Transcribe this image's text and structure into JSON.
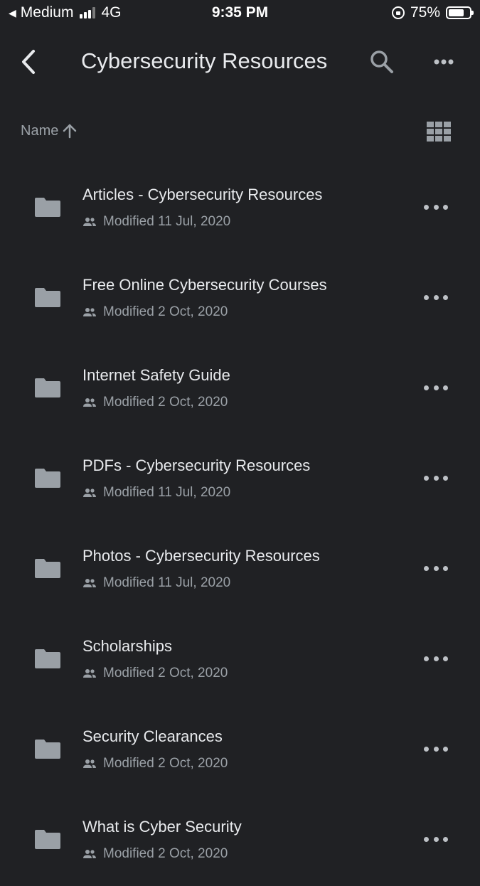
{
  "status_bar": {
    "carrier": "Medium",
    "network": "4G",
    "time": "9:35 PM",
    "battery": "75%",
    "battery_level": 0.75
  },
  "app_bar": {
    "title": "Cybersecurity Resources",
    "icons": [
      "back-arrow-icon",
      "search-icon",
      "more-horizontal-icon"
    ]
  },
  "sort": {
    "label": "Name",
    "direction_icon": "arrow-up-icon",
    "view_toggle_icon": "grid-view-icon"
  },
  "files": [
    {
      "name": "Articles - Cybersecurity Resources",
      "modified": "Modified 11 Jul, 2020"
    },
    {
      "name": "Free Online Cybersecurity Courses",
      "modified": "Modified 2 Oct, 2020"
    },
    {
      "name": "Internet Safety Guide",
      "modified": "Modified 2 Oct, 2020"
    },
    {
      "name": "PDFs - Cybersecurity Resources",
      "modified": "Modified 11 Jul, 2020"
    },
    {
      "name": "Photos - Cybersecurity Resources",
      "modified": "Modified 11 Jul, 2020"
    },
    {
      "name": "Scholarships",
      "modified": "Modified 2 Oct, 2020"
    },
    {
      "name": "Security Clearances",
      "modified": "Modified 2 Oct, 2020"
    },
    {
      "name": "What is Cyber Security",
      "modified": "Modified 2 Oct, 2020"
    }
  ],
  "colors": {
    "background": "#202124",
    "primary_text": "#e8eaed",
    "secondary_text": "#9aa0a6",
    "folder": "#9aa0a6"
  }
}
